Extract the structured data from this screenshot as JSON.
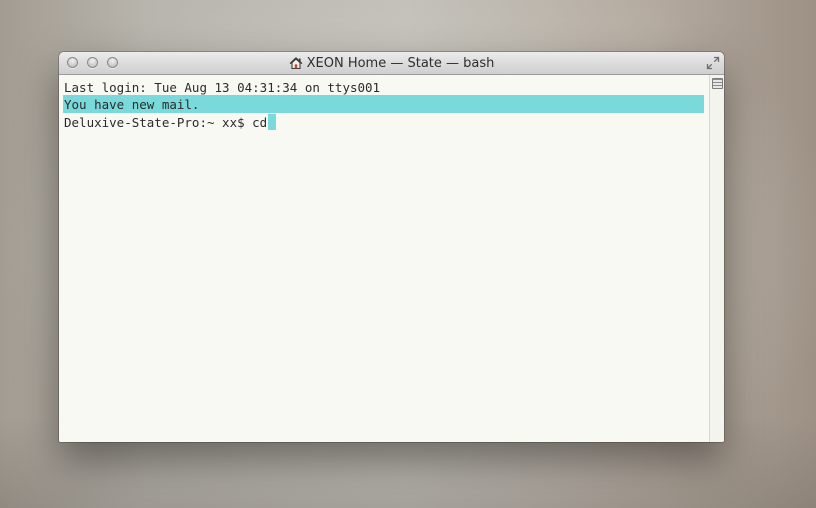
{
  "window": {
    "title": "XEON Home — State — bash",
    "title_icon": "home-icon",
    "controls": [
      "close-button",
      "minimize-button",
      "zoom-button"
    ],
    "fullscreen_icon": "fullscreen-arrows-icon"
  },
  "terminal": {
    "lines": [
      "Last login: Tue Aug 13 04:31:34 on ttys001",
      "You have new mail.",
      "Deluxive-State-Pro:~ xx$ cd"
    ],
    "highlight_color": "#79d9db",
    "background_color": "#f9f9f4",
    "text_color": "#2b2b2b"
  },
  "scrollbar": {
    "split_icon": "split-pane-icon"
  }
}
